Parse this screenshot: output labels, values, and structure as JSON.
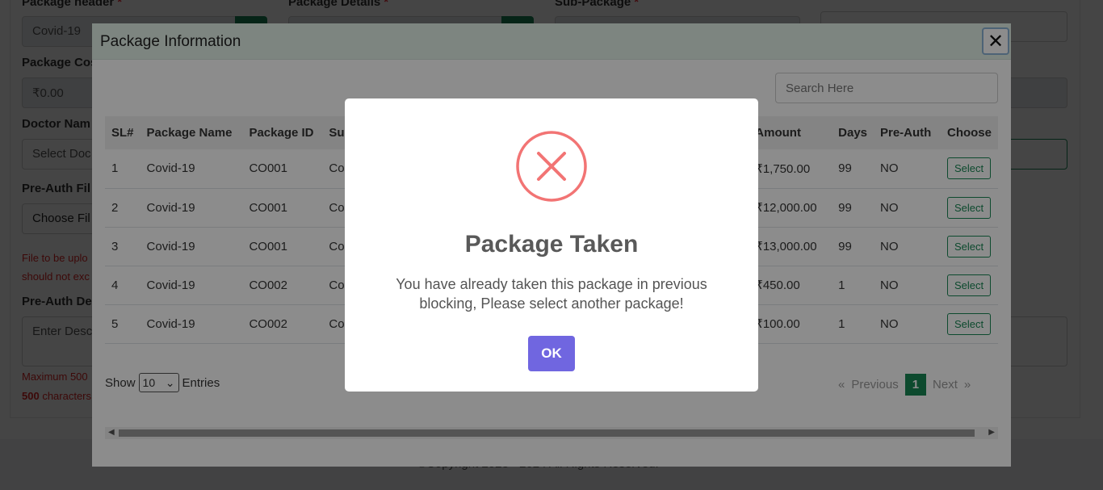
{
  "background_form": {
    "labels": {
      "package_header": "Package header",
      "package_details": "Package Details",
      "sub_package": "Sub-Package",
      "package_cost": "Package Cos",
      "doctor_name": "Doctor Nam",
      "pre_auth_file": "Pre-Auth Fil",
      "pre_auth_desc": "Pre-Auth De"
    },
    "required_mark": "*",
    "values": {
      "package_header": "Covid-19",
      "package_cost": "₹0.00",
      "doctor": "Select Doc",
      "file": "Choose Fil",
      "description": "Enter Desc"
    },
    "file_note_line1": "File to be uplo",
    "file_note_line2": "should not exc",
    "max_note_line1": "Maximum 500",
    "max_note_bold": "500",
    "max_note_rest": " characters",
    "footer": "©Copyright 2023 - 2024 All Rights Reserved."
  },
  "modal": {
    "title": "Package Information",
    "close_glyph": "✕",
    "search_placeholder": "Search Here",
    "columns": [
      "SL#",
      "Package Name",
      "Package ID",
      "Su",
      "Amount",
      "Days",
      "Pre-Auth",
      "Choose"
    ],
    "rows": [
      {
        "sl": "1",
        "name": "Covid-19",
        "id": "CO001",
        "sub": "Co",
        "amount": "₹1,750.00",
        "days": "99",
        "preauth": "NO",
        "action": "Select"
      },
      {
        "sl": "2",
        "name": "Covid-19",
        "id": "CO001",
        "sub": "Co",
        "amount": "₹12,000.00",
        "days": "99",
        "preauth": "NO",
        "action": "Select"
      },
      {
        "sl": "3",
        "name": "Covid-19",
        "id": "CO001",
        "sub": "Co",
        "amount": "₹13,000.00",
        "days": "99",
        "preauth": "NO",
        "action": "Select"
      },
      {
        "sl": "4",
        "name": "Covid-19",
        "id": "CO002",
        "sub": "Co",
        "amount": "₹450.00",
        "days": "1",
        "preauth": "NO",
        "action": "Select"
      },
      {
        "sl": "5",
        "name": "Covid-19",
        "id": "CO002",
        "sub": "Co",
        "amount": "₹100.00",
        "days": "1",
        "preauth": "NO",
        "action": "Select"
      }
    ],
    "show_label": "Show",
    "show_value": "10",
    "entries_label": "Entries",
    "pager": {
      "first": "«",
      "prev": "Previous",
      "current": "1",
      "next": "Next",
      "last": "»"
    }
  },
  "alert": {
    "title": "Package Taken",
    "message": "You have already taken this package in previous blocking, Please select another package!",
    "ok_label": "OK",
    "icon": "error-x-icon",
    "colors": {
      "icon": "#f27474",
      "button": "#7066e0"
    }
  },
  "colors": {
    "accent_green": "#198754",
    "modal_header": "#e4f2ea"
  }
}
